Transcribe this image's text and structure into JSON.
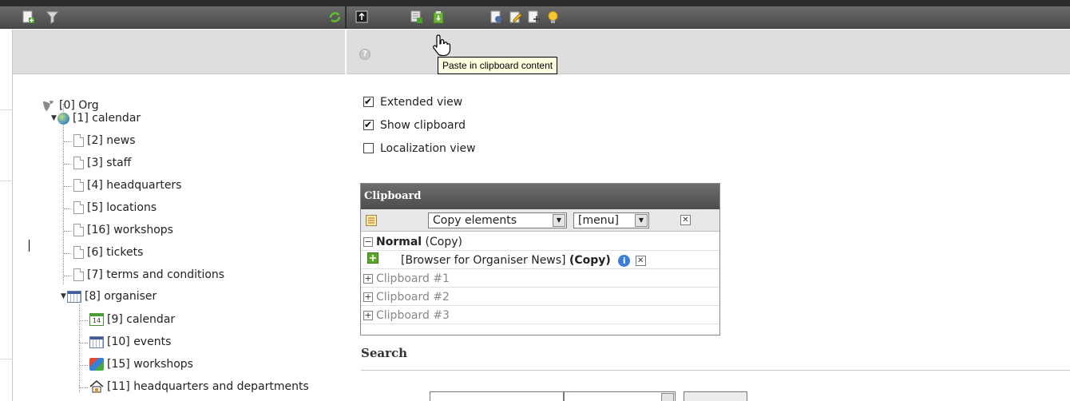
{
  "colors": {
    "toolbar": "#4a4a4a",
    "panel": "#dedede",
    "accent_green": "#5aa82b"
  },
  "toolbar": {
    "left_icons": [
      "new-page-icon",
      "filter-icon",
      "refresh-icon"
    ],
    "right_icons": [
      "move-up-icon",
      "new-record-icon",
      "paste-icon",
      "view-icon",
      "edit-icon",
      "move-icon",
      "tips-icon"
    ]
  },
  "tooltip": "Paste in clipboard content",
  "tree": {
    "root": "[0] Org",
    "calendar": "[1] calendar",
    "items": [
      "[2] news",
      "[3] staff",
      "[4] headquarters",
      "[5] locations",
      "[16] workshops",
      "[6] tickets",
      "[7] terms and conditions"
    ],
    "organiser": "[8] organiser",
    "organiser_items": [
      "[9] calendar",
      "[10] events",
      "[15] workshops",
      "[11] headquarters and departments"
    ],
    "cal_icon_text": "14"
  },
  "options": {
    "extended_view": "Extended view",
    "show_clipboard": "Show clipboard",
    "localization_view": "Localization view"
  },
  "clipboard": {
    "title": "Clipboard",
    "mode_select": "Copy elements",
    "menu_select": "[menu]",
    "normal_label": "Normal",
    "normal_suffix": "(Copy)",
    "entry_text": "[Browser for Organiser News]",
    "entry_suffix": "(Copy)",
    "pads": [
      "Clipboard #1",
      "Clipboard #2",
      "Clipboard #3"
    ]
  },
  "search": {
    "title": "Search"
  }
}
